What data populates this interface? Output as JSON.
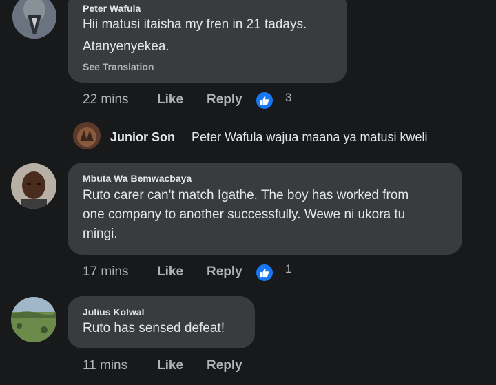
{
  "comments": [
    {
      "author": "Peter Wafula",
      "text_lines": [
        "Hii matusi itaisha my fren in 21 tadays.",
        "Atanyenyekea."
      ],
      "see_translation": "See Translation",
      "time": "22 mins",
      "like": "Like",
      "reply": "Reply",
      "reactions": "3",
      "avatar_icon": "praying-hands-avatar"
    },
    {
      "author": "Mbuta Wa Bemwacbaya",
      "text_lines": [
        "Ruto carer can't match Igathe.  The boy has worked from",
        "one company to another successfully.  Wewe ni ukora tu",
        "mingi."
      ],
      "time": "17 mins",
      "like": "Like",
      "reply": "Reply",
      "reactions": "1",
      "avatar_icon": "man-portrait-avatar"
    },
    {
      "author": "Julius Kolwal",
      "text_lines": [
        "Ruto has sensed defeat!"
      ],
      "time": "11 mins",
      "like": "Like",
      "reply": "Reply",
      "avatar_icon": "landscape-avatar"
    }
  ],
  "reply_preview": {
    "author": "Junior Son",
    "text": "Peter Wafula wajua maana ya matusi kweli",
    "avatar_icon": "hands-avatar"
  },
  "colors": {
    "background": "#18191a",
    "bubble": "#3a3b3c",
    "text": "#e4e6eb",
    "muted": "#b0b3b8",
    "like_blue": "#1877f2"
  }
}
